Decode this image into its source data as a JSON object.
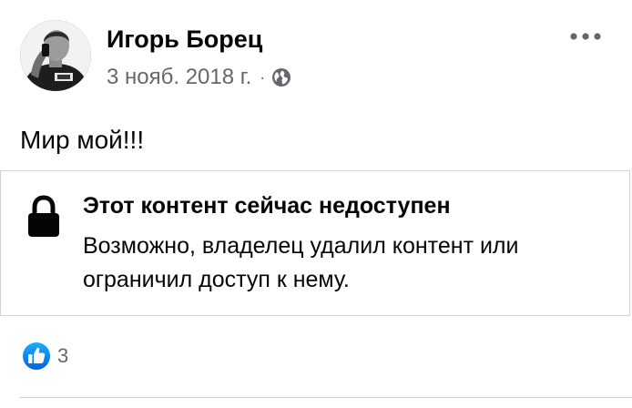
{
  "post": {
    "author": "Игорь Борец",
    "date": "3 нояб. 2018 г.",
    "separator": "·",
    "privacy_icon": "globe-icon",
    "more_icon": "more-options-icon",
    "text": "Мир мой!!!"
  },
  "unavailable": {
    "icon": "lock-icon",
    "title": "Этот контент сейчас недоступен",
    "description": "Возможно, владелец удалил контент или ограничил доступ к нему."
  },
  "reactions": {
    "icon": "like-icon",
    "count": "3"
  },
  "colors": {
    "text_primary": "#050505",
    "text_secondary": "#65676b",
    "like_blue": "#1877f2",
    "border": "#cfd2d6"
  }
}
